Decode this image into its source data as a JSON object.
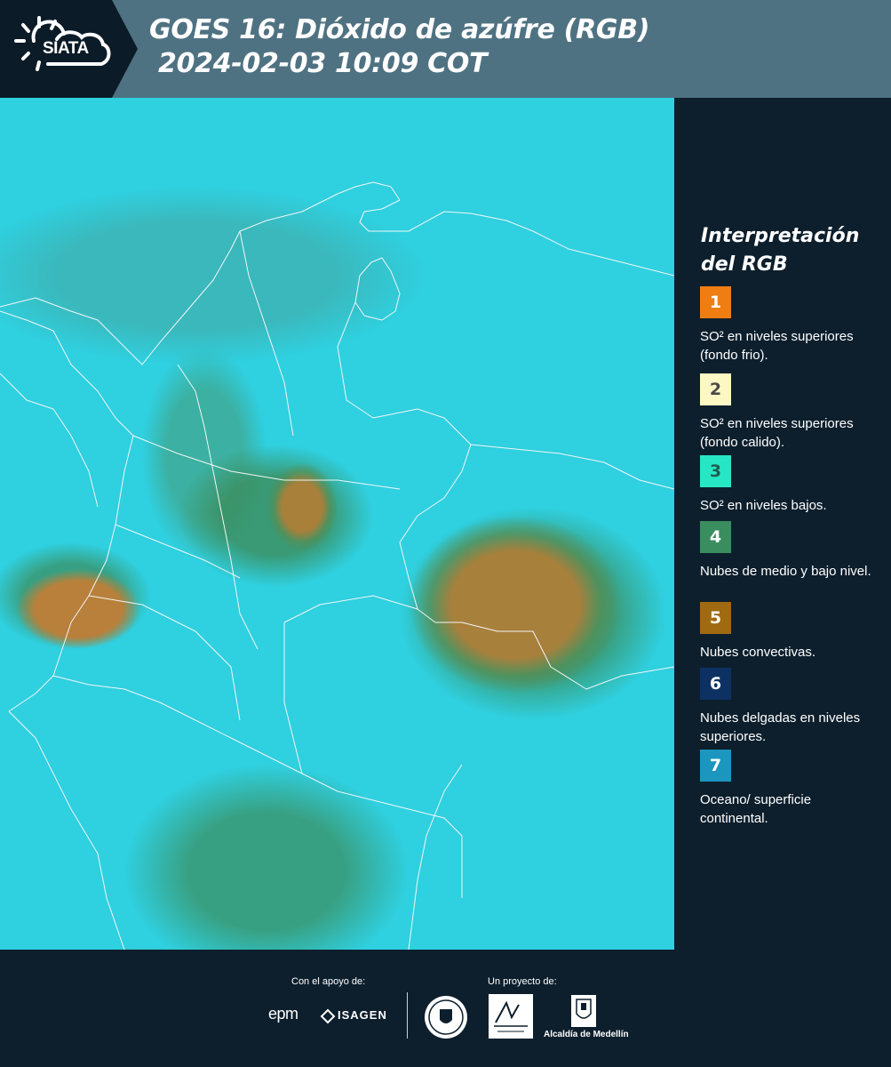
{
  "header": {
    "logo_text": "SIATA",
    "title_line1": "GOES 16: Dióxido de azúfre (RGB)",
    "title_line2": "2024-02-03 10:09 COT"
  },
  "legend": {
    "title_line1": "Interpretación",
    "title_line2": "del RGB",
    "items": [
      {
        "number": "1",
        "color": "#f07d12",
        "text_color": "#ffffff",
        "description": "SO² en niveles superiores (fondo frio)."
      },
      {
        "number": "2",
        "color": "#fdf7c3",
        "text_color": "#4a4a4a",
        "description": "SO² en niveles superiores (fondo calido)."
      },
      {
        "number": "3",
        "color": "#27e6c4",
        "text_color": "#1f5e52",
        "description": "SO² en niveles bajos."
      },
      {
        "number": "4",
        "color": "#3a8d5f",
        "text_color": "#ffffff",
        "description": "Nubes de medio y bajo nivel."
      },
      {
        "number": "5",
        "color": "#a06a10",
        "text_color": "#ffffff",
        "description": "Nubes convectivas."
      },
      {
        "number": "6",
        "color": "#0d3162",
        "text_color": "#ffffff",
        "description": "Nubes delgadas en niveles superiores."
      },
      {
        "number": "7",
        "color": "#1a96bf",
        "text_color": "#ffffff",
        "description": "Oceano/ superficie continental."
      }
    ]
  },
  "footer": {
    "support_label": "Con el apoyo de:",
    "project_label": "Un proyecto de:",
    "epm_text": "epm",
    "isagen_text": "ISAGEN",
    "alcaldia_text": "Alcaldía de Medellín"
  }
}
